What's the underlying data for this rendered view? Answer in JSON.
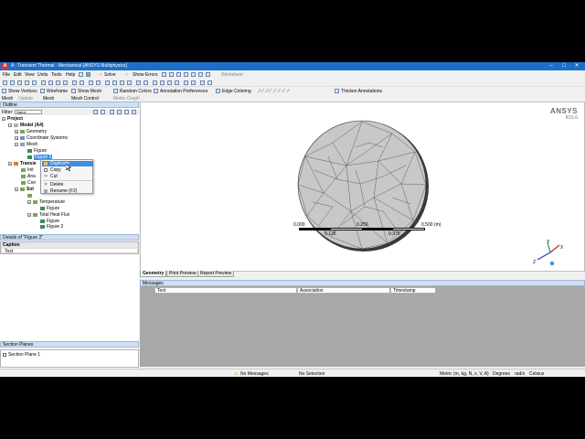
{
  "window": {
    "title": "A : Transient Thermal - Mechanical [ANSYS Multiphysics]",
    "minimize": "–",
    "maximize": "□",
    "close": "✕"
  },
  "menu": [
    "File",
    "Edit",
    "View",
    "Units",
    "Tools",
    "Help"
  ],
  "toolbar1": {
    "solve_label": "Solve",
    "show_errors_label": "Show Errors",
    "worksheet_label": "Worksheet"
  },
  "toolbar2": {
    "show_vertices": "Show Vertices",
    "wireframe": "Wireframe",
    "show_mesh": "Show Mesh",
    "random_colors": "Random Colors",
    "annotation_preferences": "Annotation Preferences",
    "edge_coloring": "Edge Coloring",
    "thicken_annotations": "Thicken Annotations"
  },
  "toolbar3": {
    "mesh_label": "Mesh",
    "update": "Update",
    "mesh_dropdown": "Mesh",
    "mesh_control": "Mesh Control",
    "metric_graph": "Metric Graph"
  },
  "outline": {
    "header": "Outline",
    "filter_label": "Filter:",
    "filter_value": "Name",
    "items": [
      {
        "label": "Project",
        "level": 0
      },
      {
        "label": "Model (A4)",
        "level": 1
      },
      {
        "label": "Geometry",
        "level": 2
      },
      {
        "label": "Coordinate Systems",
        "level": 2
      },
      {
        "label": "Mesh",
        "level": 2
      },
      {
        "label": "Figure",
        "level": 3
      },
      {
        "label": "Figure 2",
        "level": 3
      },
      {
        "label": "Transie",
        "level": 2
      },
      {
        "label": "Init",
        "level": 3
      },
      {
        "label": "Ana",
        "level": 3
      },
      {
        "label": "Con",
        "level": 3
      },
      {
        "label": "Sol",
        "level": 3
      },
      {
        "label": "",
        "level": 4
      },
      {
        "label": "Temperature",
        "level": 4
      },
      {
        "label": "Figure",
        "level": 5
      },
      {
        "label": "Total Heat Flux",
        "level": 4
      },
      {
        "label": "Figure",
        "level": 5
      },
      {
        "label": "Figure 2",
        "level": 5
      }
    ]
  },
  "context_menu": {
    "items": [
      {
        "label": "Duplicate",
        "highlighted": true
      },
      {
        "label": "Copy",
        "highlighted": false
      },
      {
        "label": "Cut",
        "highlighted": false
      },
      {
        "label": "Delete",
        "highlighted": false
      },
      {
        "label": "Rename (F2)",
        "highlighted": false
      }
    ]
  },
  "details": {
    "header": "Details of \"Figure 2\"",
    "caption_label": "Caption",
    "text_label": "Text"
  },
  "section_planes": {
    "header": "Section Planes",
    "item": "Section Plane 1"
  },
  "viewport": {
    "brand": "ANSYS",
    "version": "R15.0",
    "scale_labels": [
      "0.000",
      "0.250",
      "0.500 (m)",
      "0.125",
      "0.375"
    ],
    "triad": {
      "x": "X",
      "y": "Y",
      "z": "Z"
    }
  },
  "tabs": [
    "Geometry",
    "Print Preview",
    "Report Preview"
  ],
  "messages": {
    "header": "Messages",
    "columns": [
      "Text",
      "Association",
      "Timestamp"
    ]
  },
  "status": {
    "messages": "No Messages",
    "selection": "No Selection",
    "units": "Metric (m, kg, N, s, V, A)",
    "angle": "Degrees",
    "rate": "rad/s",
    "temp": "Celsius"
  },
  "colors": {
    "title_bar": "#1c6fc9",
    "highlight": "#3d8ee0",
    "panel_header": "#cfe0f3",
    "mesh_fill": "#c8c8c8"
  }
}
